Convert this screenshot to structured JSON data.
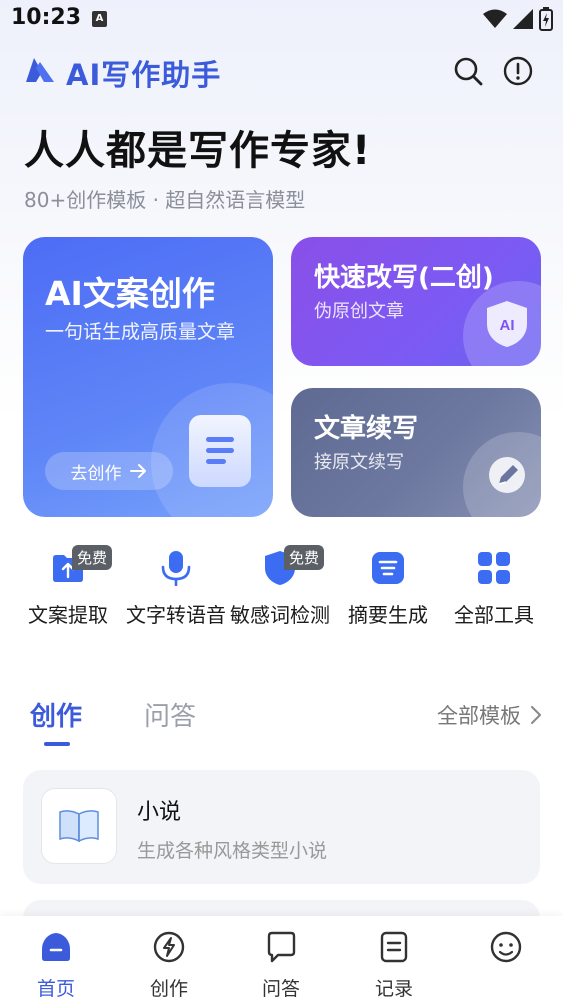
{
  "status_bar": {
    "time": "10:23",
    "notification_glyph": "A"
  },
  "header": {
    "title": "AI写作助手"
  },
  "hero": {
    "title": "人人都是写作专家!",
    "subtitle": "80+创作模板 · 超自然语言模型"
  },
  "cards": {
    "main": {
      "title": "AI文案创作",
      "subtitle": "一句话生成高质量文章",
      "button": "去创作"
    },
    "rewrite": {
      "title": "快速改写(二创)",
      "subtitle": "伪原创文章",
      "badge": "AI"
    },
    "continue": {
      "title": "文章续写",
      "subtitle": "接原文续写"
    }
  },
  "tools": [
    {
      "label": "文案提取",
      "badge": "免费",
      "icon": "upload-folder-icon"
    },
    {
      "label": "文字转语音",
      "badge": "",
      "icon": "microphone-icon"
    },
    {
      "label": "敏感词检测",
      "badge": "免费",
      "icon": "shield-icon"
    },
    {
      "label": "摘要生成",
      "badge": "",
      "icon": "summary-icon"
    },
    {
      "label": "全部工具",
      "badge": "",
      "icon": "grid-icon"
    }
  ],
  "tabs": {
    "create": "创作",
    "qa": "问答",
    "all_templates": "全部模板"
  },
  "list": [
    {
      "title": "小说",
      "subtitle": "生成各种风格类型小说",
      "icon": "book-icon"
    }
  ],
  "bottom_nav": [
    {
      "label": "首页",
      "icon": "home-icon",
      "active": true
    },
    {
      "label": "创作",
      "icon": "lightning-icon",
      "active": false
    },
    {
      "label": "问答",
      "icon": "chat-bubble-icon",
      "active": false
    },
    {
      "label": "记录",
      "icon": "record-icon",
      "active": false
    },
    {
      "label": "",
      "icon": "profile-icon",
      "active": false
    }
  ],
  "colors": {
    "accent": "#3b5bdb",
    "main_card": "#5a7cf6",
    "rewrite_card": "#7c55f0",
    "continue_card": "#6b76a0"
  }
}
